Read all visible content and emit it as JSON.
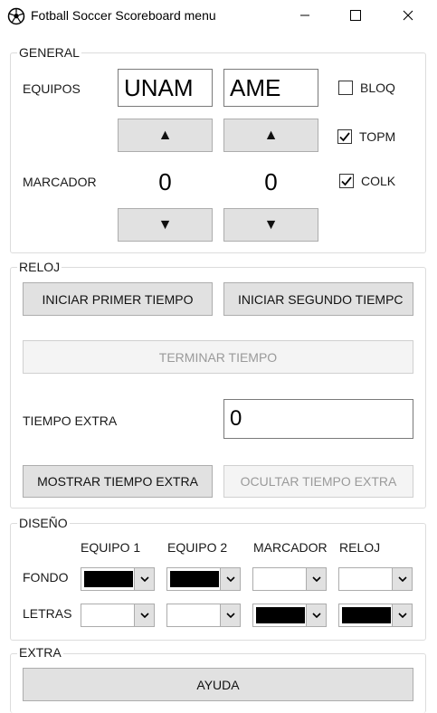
{
  "window": {
    "title": "Fotball Soccer Scoreboard menu",
    "app_icon": "soccer-ball-icon",
    "minimize_icon": "minimize-icon",
    "maximize_icon": "maximize-icon",
    "close_icon": "close-icon"
  },
  "general": {
    "legend": "GENERAL",
    "equipos_label": "EQUIPOS",
    "team1": "UNAM",
    "team2": "AME",
    "up_arrow": "▲",
    "down_arrow": "▼",
    "marcador_label": "MARCADOR",
    "score1": "0",
    "score2": "0",
    "checkboxes": [
      {
        "label": "BLOQ",
        "checked": false
      },
      {
        "label": "TOPM",
        "checked": true
      },
      {
        "label": "COLK",
        "checked": true
      }
    ]
  },
  "reloj": {
    "legend": "RELOJ",
    "start_first": "INICIAR PRIMER TIEMPO",
    "start_second": "INICIAR SEGUNDO TIEMPC",
    "end_time": "TERMINAR TIEMPO",
    "extra_label": "TIEMPO EXTRA",
    "extra_value": "0",
    "show_extra": "MOSTRAR TIEMPO EXTRA",
    "hide_extra": "OCULTAR TIEMPO EXTRA"
  },
  "diseno": {
    "legend": "DISEÑO",
    "columns": [
      "EQUIPO 1",
      "EQUIPO 2",
      "MARCADOR",
      "RELOJ"
    ],
    "rows": [
      {
        "label": "FONDO",
        "colors": [
          "#000000",
          "#000000",
          "#ffffff",
          "#ffffff"
        ]
      },
      {
        "label": "LETRAS",
        "colors": [
          "#ffffff",
          "#ffffff",
          "#000000",
          "#000000"
        ]
      }
    ]
  },
  "extra": {
    "legend": "EXTRA",
    "help": "AYUDA"
  }
}
